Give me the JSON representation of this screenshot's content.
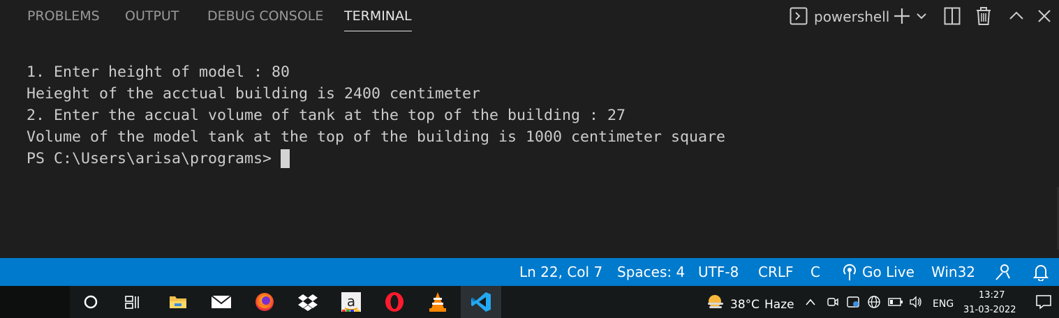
{
  "panel": {
    "tabs": [
      {
        "label": "PROBLEMS"
      },
      {
        "label": "OUTPUT"
      },
      {
        "label": "DEBUG CONSOLE"
      },
      {
        "label": "TERMINAL"
      }
    ],
    "active_tab": "TERMINAL",
    "shell_name": "powershell",
    "icons": [
      "terminal-icon",
      "plus-icon",
      "chevron-down-icon",
      "split-icon",
      "trash-icon",
      "chevron-up-icon",
      "close-icon"
    ]
  },
  "terminal": {
    "lines": [
      "1. Enter height of model : 80",
      "Heieght of the acctual building is 2400 centimeter",
      "2. Enter the accual volume of tank at the top of the building : 27",
      "Volume of the model tank at the top of the building is 1000 centimeter square",
      "PS C:\\Users\\arisa\\programs> "
    ]
  },
  "statusbar": {
    "position": "Ln 22, Col 7",
    "spaces": "Spaces: 4",
    "encoding": "UTF-8",
    "eol": "CRLF",
    "language": "C",
    "go_live": "Go Live",
    "platform": "Win32",
    "background_color": "#007acc"
  },
  "taskbar": {
    "apps": [
      "cortana-icon",
      "task-view-icon",
      "file-explorer-icon",
      "mail-icon",
      "firefox-icon",
      "dropbox-icon",
      "amazon-icon",
      "opera-icon",
      "vlc-icon",
      "vscode-icon"
    ],
    "weather": {
      "temp": "38°C",
      "condition": "Haze"
    },
    "language": "ENG",
    "time": "13:27",
    "date": "31-03-2022"
  }
}
